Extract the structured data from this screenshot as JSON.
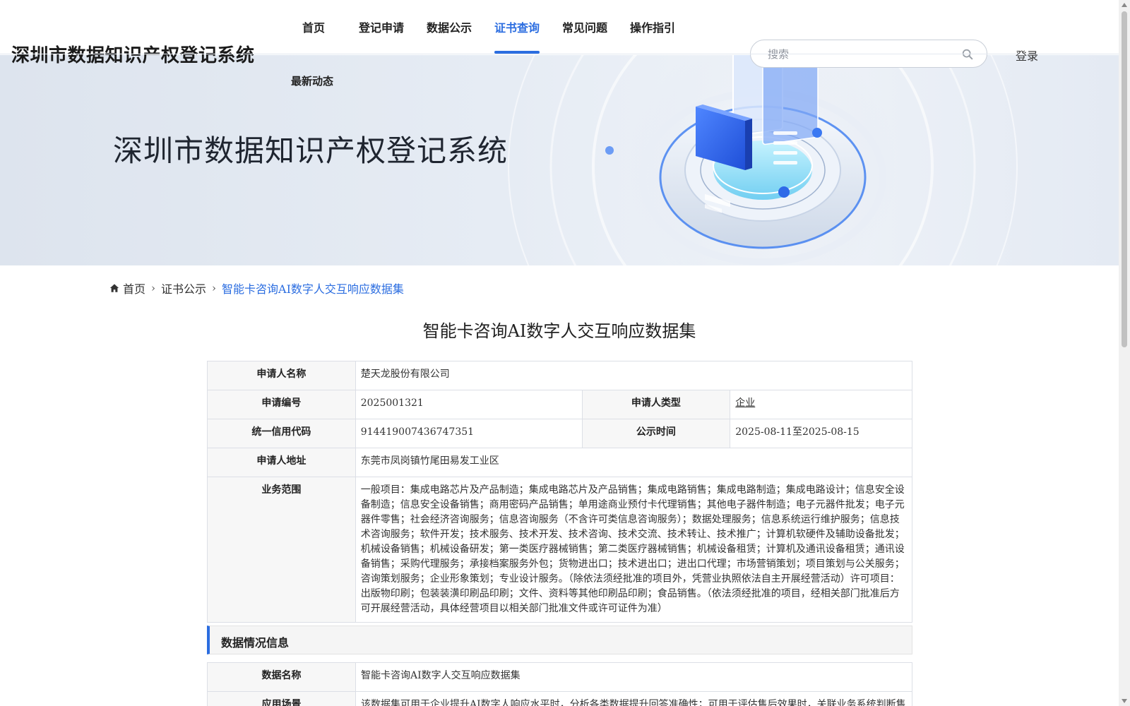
{
  "header": {
    "site_title": "深圳市数据知识产权登记系统",
    "nav": [
      "首页",
      "登记申请",
      "数据公示",
      "证书查询",
      "常见问题",
      "操作指引"
    ],
    "nav_sub": "最新动态",
    "active_nav": "证书查询",
    "search_placeholder": "搜索",
    "search_value": "",
    "login": "登录"
  },
  "banner": {
    "title": "深圳市数据知识产权登记系统"
  },
  "breadcrumb": {
    "home": "首页",
    "level1": "证书公示",
    "current": "智能卡咨询AI数字人交互响应数据集"
  },
  "detail": {
    "title": "智能卡咨询AI数字人交互响应数据集",
    "applicant_name_label": "申请人名称",
    "applicant_name": "楚天龙股份有限公司",
    "app_no_label": "申请编号",
    "app_no": "2025001321",
    "applicant_type_label": "申请人类型",
    "applicant_type": "企业",
    "credit_code_label": "统一信用代码",
    "credit_code": "914419007436747351",
    "publicity_label": "公示时间",
    "publicity_time": "2025-08-11至2025-08-15",
    "address_label": "申请人地址",
    "address": "东莞市凤岗镇竹尾田易发工业区",
    "scope_label": "业务范围",
    "scope": "一般项目：集成电路芯片及产品制造；集成电路芯片及产品销售；集成电路销售；集成电路制造；集成电路设计；信息安全设备制造；信息安全设备销售；商用密码产品销售；单用途商业预付卡代理销售；其他电子器件制造；电子元器件批发；电子元器件零售；社会经济咨询服务；信息咨询服务（不含许可类信息咨询服务）；数据处理服务；信息系统运行维护服务；信息技术咨询服务；软件开发；技术服务、技术开发、技术咨询、技术交流、技术转让、技术推广；计算机软硬件及辅助设备批发；机械设备销售；机械设备研发；第一类医疗器械销售；第二类医疗器械销售；机械设备租赁；计算机及通讯设备租赁；通讯设备销售；采购代理服务；承接档案服务外包；货物进出口；技术进出口；进出口代理；市场营销策划；项目策划与公关服务；咨询策划服务；企业形象策划；专业设计服务。（除依法须经批准的项目外，凭营业执照依法自主开展经营活动）许可项目：出版物印刷；包装装潢印刷品印刷；文件、资料等其他印刷品印刷；食品销售。（依法须经批准的项目，经相关部门批准后方可开展经营活动，具体经营项目以相关部门批准文件或许可证件为准）"
  },
  "data_section": {
    "heading": "数据情况信息",
    "name_label": "数据名称",
    "name": "智能卡咨询AI数字人交互响应数据集",
    "scene_label": "应用场景",
    "scene": "该数据集可用于企业提升AI数字人响应水平时，分析各类数据提升回答准确性；可用于评估售后效果时，关联业务系统判断售"
  },
  "colors": {
    "accent": "#2b6de0",
    "label_bg": "#f7f7f7",
    "border": "#dcdfe6"
  }
}
